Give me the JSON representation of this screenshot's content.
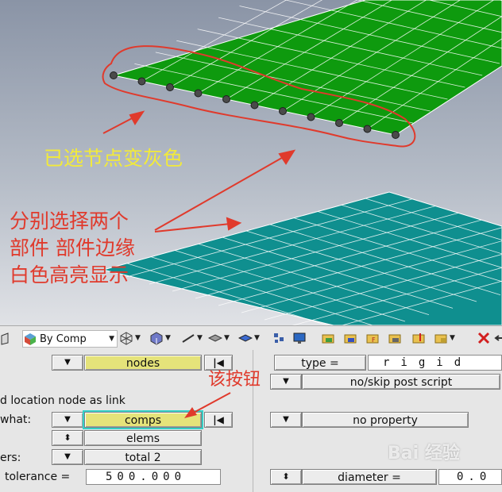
{
  "annotations": {
    "selected_nodes": "已选节点变灰色",
    "select_two_line1": "分别选择两个",
    "select_two_line2": "部件 部件边缘",
    "select_two_line3": "白色高亮显示",
    "this_button": "该按钮"
  },
  "toolbar": {
    "color_mode": "By Comp"
  },
  "panel": {
    "left": {
      "row1_selector": "nodes",
      "option_text": "d location node as link",
      "what_label": "what:",
      "what_selector": "comps",
      "elems_selector": "elems",
      "members_label": "ers:",
      "total_selector": "total 2",
      "tolerance_label": "tolerance =",
      "tolerance_value": "500.000"
    },
    "right": {
      "type_label": "type =",
      "type_value": "rigid",
      "post_script": "no/skip post script",
      "property": "no property",
      "diameter_label": "diameter =",
      "diameter_value": "0.0"
    }
  },
  "watermark": "Bai 经验",
  "colors": {
    "upper_plate": "#0e9a0e",
    "lower_plate": "#0f8f8f",
    "annotation_red": "#e03a2c",
    "annotation_yellow": "#f2ea3a",
    "selector_yellow": "#e5e37a"
  }
}
